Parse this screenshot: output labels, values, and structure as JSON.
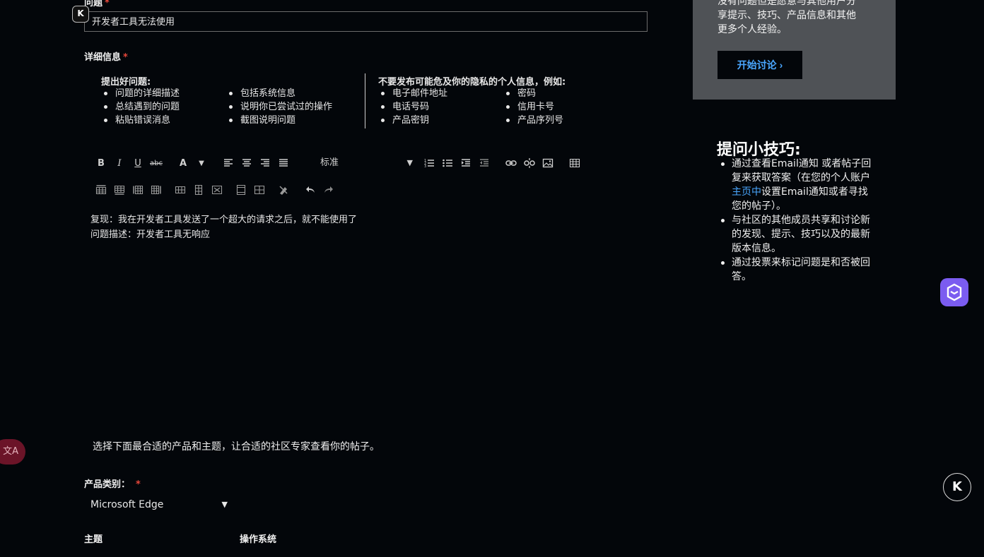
{
  "form": {
    "question_label": "问题",
    "question_value": "开发者工具无法使用",
    "details_label": "详细信息",
    "good_title": "提出好问题:",
    "good_col1": [
      "问题的详细描述",
      "总结遇到的问题",
      "粘贴错误消息"
    ],
    "good_col2": [
      "包括系统信息",
      "说明你已尝试过的操作",
      "截图说明问题"
    ],
    "privacy_title": "不要发布可能危及你的隐私的个人信息，例如:",
    "privacy_col1": [
      "电子邮件地址",
      "电话号码",
      "产品密钥"
    ],
    "privacy_col2": [
      "密码",
      "信用卡号",
      "产品序列号"
    ],
    "style_select": "标准",
    "editor_line1": "复现：我在开发者工具发送了一个超大的请求之后，就不能使用了",
    "editor_line2": "问题描述：开发者工具无响应",
    "hint": "选择下面最合适的产品和主题，让合适的社区专家查看你的帖子。",
    "product_label": "产品类别：",
    "product_value": "Microsoft Edge",
    "topic_label": "主题",
    "os_label": "操作系统"
  },
  "panel": {
    "lines": [
      "没有问题但是愿意与其他用户分",
      "享提示、技巧、产品信息和其他",
      "更多个人经验。"
    ],
    "button_label": "开始讨论"
  },
  "tips": {
    "heading": "提问小技巧:",
    "item1_pre": "通过查看Email通知 或者帖子回复来获取答案（在您的个人账户",
    "item1_link": "主页中",
    "item1_post": "设置Email通知或者寻找您的帖子）。",
    "item2": "与社区的其他成员共享和讨论新的发现、提示、技巧以及的最新版本信息。",
    "item3": "通过投票来标记问题是和否被回答。"
  },
  "floating": {
    "k_label": "K",
    "translate_label": "文A"
  },
  "colors": {
    "background": "#03060a",
    "panel": "#4f5256",
    "link": "#4aa7ff",
    "required": "#e8473a",
    "assistant": "#7b5cf0"
  },
  "icons": [
    "bold-icon",
    "italic-icon",
    "underline-icon",
    "strikethrough-icon",
    "font-color-icon",
    "align-left-icon",
    "align-center-icon",
    "align-right-icon",
    "justify-icon",
    "numbered-list-icon",
    "bullet-list-icon",
    "indent-icon",
    "outdent-icon",
    "link-icon",
    "unlink-icon",
    "image-icon",
    "table-icon"
  ]
}
